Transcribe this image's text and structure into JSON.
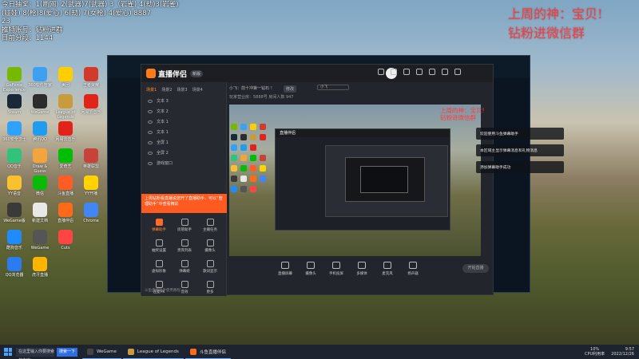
{
  "overlay_left": {
    "lines": [
      "今日抽奖：1(断网) 2(武器)7(武器) 3（岩雀) 4(劫)3(岩雀)",
      "(娃娃) 8(枪)8(爱心) 6(劫) 7(女枪) 4(爱心) 8887",
      "23",
      "推特账号：钻粉进群",
      "目前分段：1144"
    ]
  },
  "overlay_right": {
    "line1": "上周的神：宝贝!",
    "line2": "钻粉进微信群"
  },
  "desktop_icons": [
    {
      "label": "GeForce Experience",
      "color": "#76b900"
    },
    {
      "label": "360软件管家",
      "color": "#3ea0f0"
    },
    {
      "label": "美团",
      "color": "#ffce00"
    },
    {
      "label": "王者荣耀",
      "color": "#d23b2b"
    },
    {
      "label": "Steam",
      "color": "#1b2838"
    },
    {
      "label": "WeGame",
      "color": "#2c2c2c"
    },
    {
      "label": "League of Legends",
      "color": "#c89b3c"
    },
    {
      "label": "网易云音乐",
      "color": "#e2231a"
    },
    {
      "label": "360安全卫士",
      "color": "#2fa2ff"
    },
    {
      "label": "腾讯QQ",
      "color": "#1f9cf0"
    },
    {
      "label": "网易云音乐",
      "color": "#e2231a"
    },
    {
      "label": "",
      "color": "transparent"
    },
    {
      "label": "QQ音乐",
      "color": "#31c27c"
    },
    {
      "label": "Draw & Guess",
      "color": "#f3a43c"
    },
    {
      "label": "爱奇艺",
      "color": "#00be06"
    },
    {
      "label": "英雄联盟",
      "color": "#c8413a"
    },
    {
      "label": "YY语音",
      "color": "#f8c12d"
    },
    {
      "label": "微信",
      "color": "#09bb07"
    },
    {
      "label": "斗鱼直播",
      "color": "#ff5d23"
    },
    {
      "label": "YY开播",
      "color": "#ffd200"
    },
    {
      "label": "WeGame版",
      "color": "#3a3a3a"
    },
    {
      "label": "新建文档",
      "color": "#e8e8e8"
    },
    {
      "label": "直播伴侣",
      "color": "#ff6a1a"
    },
    {
      "label": "Chrome",
      "color": "#4285f4"
    },
    {
      "label": "酷狗音乐",
      "color": "#1e8bff"
    },
    {
      "label": "WeGame",
      "color": "#555555"
    },
    {
      "label": "Cuts",
      "color": "#ff4444"
    },
    {
      "label": "",
      "color": "transparent"
    },
    {
      "label": "QQ浏览器",
      "color": "#2d7bf0"
    },
    {
      "label": "虎牙直播",
      "color": "#ffb400"
    }
  ],
  "app": {
    "logo": "直播伴侣",
    "version_badge": "新版",
    "scene_tabs": [
      "场景1",
      "场景2",
      "场景3",
      "场景4"
    ],
    "sources": [
      "文本 3",
      "文本 2",
      "文本 1",
      "文本 1",
      "全屏 1",
      "全屏 2",
      "游戏窗口"
    ],
    "tip_text": "上周钻粉看直播说您开了直播助手，可以“管理助手”中查看精彩",
    "tools": [
      {
        "label": "弹幕助手",
        "active": true
      },
      {
        "label": "房管助手",
        "active": false
      },
      {
        "label": "主播任务",
        "active": false
      },
      {
        "label": "抽奖设置",
        "active": false
      },
      {
        "label": "贵宾列表",
        "active": false
      },
      {
        "label": "摄像头",
        "active": false
      },
      {
        "label": "虚拟形象",
        "active": false
      },
      {
        "label": "弹幕姬",
        "active": false
      },
      {
        "label": "歌词显示",
        "active": false
      },
      {
        "label": "连麦PK",
        "active": false
      },
      {
        "label": "音效",
        "active": false
      },
      {
        "label": "更多",
        "active": false
      }
    ],
    "left_footer": "斗鱼直播助手使用教程",
    "room_title": "小飞：前十冲第一钻石 ！",
    "live_badge": "修改",
    "room_name_input": "小飞",
    "room_info": "玩家营业房：5888号    房间人数 947",
    "bottom_tools": [
      "直播屏幕",
      "摄像头",
      "手机投屏",
      "多媒体",
      "麦克风",
      "扬声器"
    ],
    "start_button": "开始直播"
  },
  "notifications": [
    "欢迎使用斗鱼弹幕助手",
    "本区域主显示弹幕消息和礼物消息",
    "添加弹幕助手成功"
  ],
  "preview_overlay": {
    "line1": "上周的神：宝贝!",
    "line2": "钻粉进微信群"
  },
  "taskbar": {
    "search_placeholder": "在这里输入你要搜索的内容",
    "search_button": "搜索一下",
    "items": [
      "WeGame",
      "League of Legends",
      "斗鱼直播伴侣"
    ],
    "cpu": "10%",
    "cpu_label": "CPU利用率",
    "time": "9:57",
    "date": "2022/12/26"
  }
}
